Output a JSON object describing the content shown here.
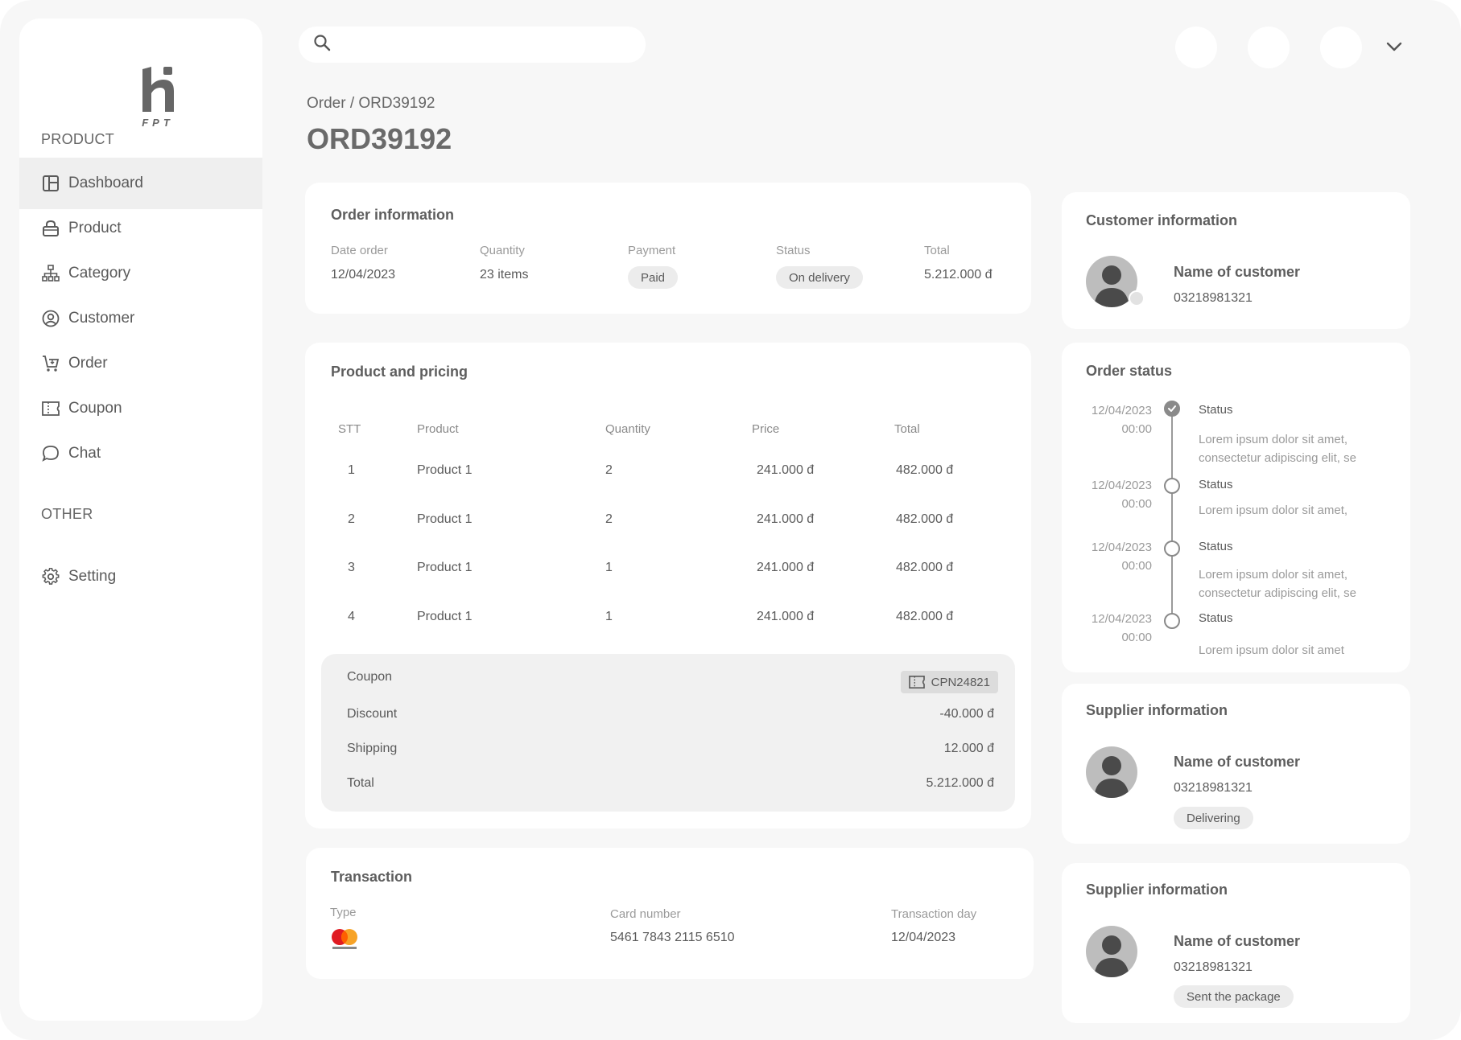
{
  "sidebar": {
    "logo_text": "FPT",
    "section_product": "PRODUCT",
    "section_other": "OTHER",
    "items": [
      {
        "label": "Dashboard",
        "icon": "dashboard-icon"
      },
      {
        "label": "Product",
        "icon": "bag-icon"
      },
      {
        "label": "Category",
        "icon": "hierarchy-icon"
      },
      {
        "label": "Customer",
        "icon": "user-circle-icon"
      },
      {
        "label": "Order",
        "icon": "cart-icon"
      },
      {
        "label": "Coupon",
        "icon": "ticket-icon"
      },
      {
        "label": "Chat",
        "icon": "chat-icon"
      }
    ],
    "setting": {
      "label": "Setting",
      "icon": "gear-icon"
    }
  },
  "search": {
    "placeholder": "",
    "value": ""
  },
  "breadcrumb": "Order / ORD39192",
  "page_title": "ORD39192",
  "order_info": {
    "title": "Order information",
    "date_label": "Date order",
    "date_value": "12/04/2023",
    "qty_label": "Quantity",
    "qty_value": "23 items",
    "payment_label": "Payment",
    "payment_value": "Paid",
    "status_label": "Status",
    "status_value": "On delivery",
    "total_label": "Total",
    "total_value": "5.212.000 đ"
  },
  "pricing": {
    "title": "Product and pricing",
    "headers": [
      "STT",
      "Product",
      "Quantity",
      "Price",
      "Total"
    ],
    "rows": [
      [
        "1",
        "Product 1",
        "2",
        "241.000 đ",
        "482.000 đ"
      ],
      [
        "2",
        "Product 1",
        "2",
        "241.000 đ",
        "482.000 đ"
      ],
      [
        "3",
        "Product 1",
        "1",
        "241.000 đ",
        "482.000 đ"
      ],
      [
        "4",
        "Product 1",
        "1",
        "241.000 đ",
        "482.000 đ"
      ]
    ],
    "summary": {
      "coupon_label": "Coupon",
      "coupon_code": "CPN24821",
      "discount_label": "Discount",
      "discount_value": "-40.000 đ",
      "shipping_label": "Shipping",
      "shipping_value": "12.000 đ",
      "total_label": "Total",
      "total_value": "5.212.000 đ"
    }
  },
  "transaction": {
    "title": "Transaction",
    "type_label": "Type",
    "type_brand": "mastercard",
    "card_label": "Card number",
    "card_value": "5461 7843 2115 6510",
    "day_label": "Transaction day",
    "day_value": "12/04/2023"
  },
  "customer": {
    "title": "Customer information",
    "name": "Name of customer",
    "phone": "03218981321"
  },
  "order_status": {
    "title": "Order status",
    "events": [
      {
        "date": "12/04/2023",
        "time": "00:00",
        "status": "Status",
        "desc": "Lorem ipsum dolor sit amet, consectetur adipiscing elit, se",
        "done": true
      },
      {
        "date": "12/04/2023",
        "time": "00:00",
        "status": "Status",
        "desc": "Lorem ipsum dolor sit amet,",
        "done": false
      },
      {
        "date": "12/04/2023",
        "time": "00:00",
        "status": "Status",
        "desc": "Lorem ipsum dolor sit amet, consectetur adipiscing elit, se",
        "done": false
      },
      {
        "date": "12/04/2023",
        "time": "00:00",
        "status": "Status",
        "desc": "Lorem ipsum dolor sit amet",
        "done": false
      }
    ]
  },
  "suppliers": [
    {
      "title": "Supplier information",
      "name": "Name of customer",
      "phone": "03218981321",
      "badge": "Delivering"
    },
    {
      "title": "Supplier information",
      "name": "Name of customer",
      "phone": "03218981321",
      "badge": "Sent the package"
    }
  ],
  "colors": {
    "background": "#f7f7f7",
    "card": "#ffffff",
    "active_nav": "#efefef",
    "pill": "#ececec",
    "text": "#5a5a5a"
  }
}
